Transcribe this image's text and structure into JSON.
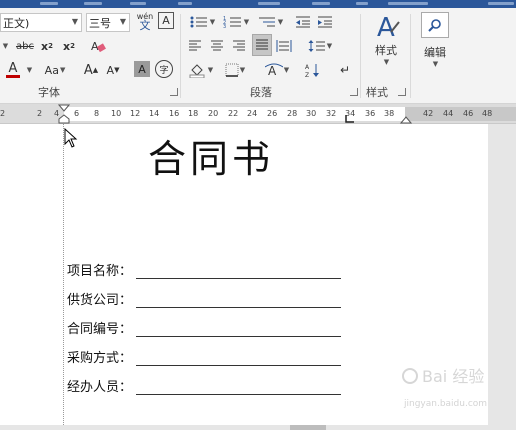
{
  "ribbon": {
    "font_name": "正文)",
    "font_size": "三号",
    "phonetic_label": "wén",
    "phonetic_char": "文",
    "charborder_glyph": "A",
    "strike_label": "abc",
    "sub_label": "x",
    "sub_sub": "2",
    "sup_label": "x",
    "sup_sup": "2",
    "font_color_glyph": "A",
    "change_case_label": "Aa",
    "grow_label": "A",
    "shrink_label": "A",
    "shade_glyph": "A",
    "enclose_glyph": "字",
    "font_group_label": "字体",
    "para_group_label": "段落",
    "styles_label": "样式",
    "styles_group_label": "样式",
    "edit_label": "编辑",
    "accent_red": "#c00000"
  },
  "ruler": {
    "ticks": [
      "2",
      "2",
      "4",
      "6",
      "8",
      "10",
      "12",
      "14",
      "16",
      "18",
      "20",
      "22",
      "24",
      "26",
      "28",
      "30",
      "32",
      "34",
      "36",
      "38",
      "42",
      "44",
      "46",
      "48"
    ]
  },
  "document": {
    "title": "合同书",
    "fields": [
      {
        "label": "项目名称："
      },
      {
        "label": "供货公司："
      },
      {
        "label": "合同编号："
      },
      {
        "label": "采购方式："
      },
      {
        "label": "经办人员："
      }
    ]
  },
  "watermark": "jingyan.baidu.com"
}
